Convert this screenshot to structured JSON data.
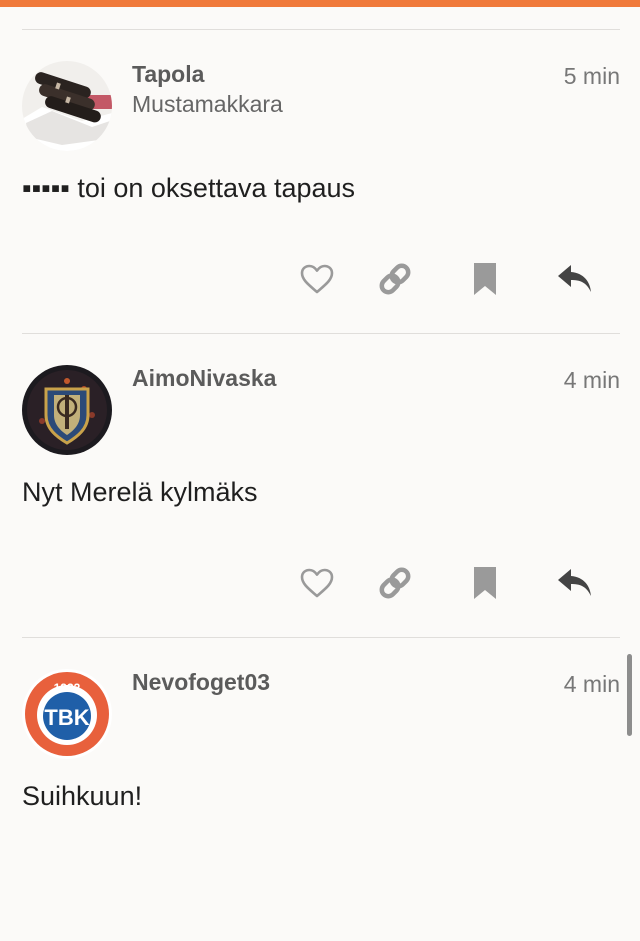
{
  "colors": {
    "accent": "#f07a3b",
    "icon_light": "#9a9a9a",
    "icon_dark": "#444444"
  },
  "posts": [
    {
      "username": "Tapola",
      "user_title": "Mustamakkara",
      "time": "5 min",
      "text": "▪▪▪▪▪ toi on oksettava tapaus",
      "avatar": "sausage-avatar"
    },
    {
      "username": "AimoNivaska",
      "user_title": "",
      "time": "4 min",
      "text": "Nyt Merelä kylmäks",
      "avatar": "shield-crest-avatar"
    },
    {
      "username": "Nevofoget03",
      "user_title": "",
      "time": "4 min",
      "text": "Suihkuun!",
      "avatar": "tbk-logo-avatar",
      "logo_text": "1932 TBK"
    }
  ],
  "action_icons": [
    "heart-icon",
    "link-icon",
    "bookmark-icon",
    "reply-icon"
  ]
}
